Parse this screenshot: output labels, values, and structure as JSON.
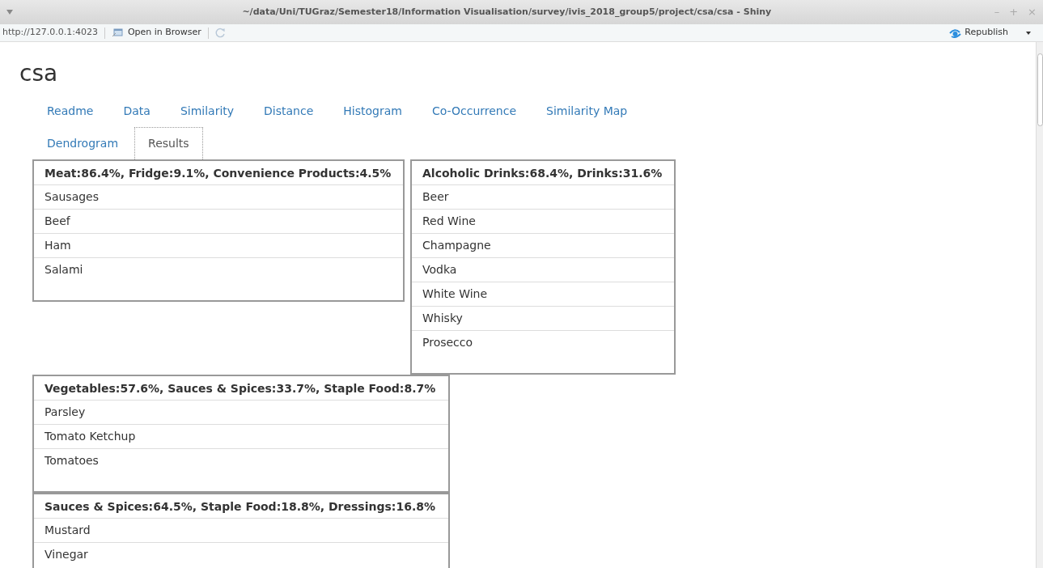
{
  "window": {
    "title": "~/data/Uni/TUGraz/Semester18/Information Visualisation/survey/ivis_2018_group5/project/csa/csa - Shiny",
    "controls": [
      "–",
      "+",
      "×"
    ]
  },
  "toolbar": {
    "url": "http://127.0.0.1:4023",
    "open_button": "Open in Browser",
    "republish": "Republish"
  },
  "app_title": "csa",
  "tabs": [
    {
      "label": "Readme",
      "selected": false
    },
    {
      "label": "Data",
      "selected": false
    },
    {
      "label": "Similarity",
      "selected": false
    },
    {
      "label": "Distance",
      "selected": false
    },
    {
      "label": "Histogram",
      "selected": false
    },
    {
      "label": "Co-Occurrence",
      "selected": false
    },
    {
      "label": "Similarity Map",
      "selected": false
    },
    {
      "label": "Dendrogram",
      "selected": false
    },
    {
      "label": "Results",
      "selected": true
    }
  ],
  "clusters": [
    {
      "header": "Meat:86.4%, Fridge:9.1%, Convenience Products:4.5%",
      "items": [
        "Sausages",
        "Beef",
        "Ham",
        "Salami"
      ]
    },
    {
      "header": "Alcoholic Drinks:68.4%, Drinks:31.6%",
      "items": [
        "Beer",
        "Red Wine",
        "Champagne",
        "Vodka",
        "White Wine",
        "Whisky",
        "Prosecco"
      ]
    },
    {
      "header": "Vegetables:57.6%, Sauces & Spices:33.7%, Staple Food:8.7%",
      "items": [
        "Parsley",
        "Tomato Ketchup",
        "Tomatoes"
      ]
    },
    {
      "header": "Sauces & Spices:64.5%, Staple Food:18.8%, Dressings:16.8%",
      "items": [
        "Mustard",
        "Vinegar"
      ]
    }
  ]
}
